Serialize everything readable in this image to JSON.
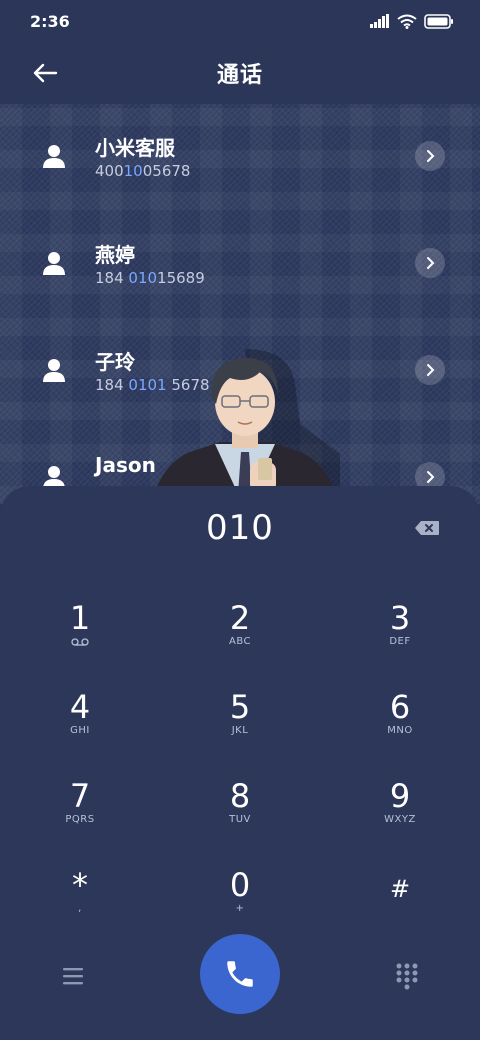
{
  "status_bar": {
    "time": "2:36"
  },
  "header": {
    "title": "通话"
  },
  "contacts": [
    {
      "name": "小米客服",
      "number_parts": [
        {
          "text": "400"
        },
        {
          "text": "10",
          "hl": true
        },
        {
          "text": "05678"
        }
      ]
    },
    {
      "name": "燕婷",
      "number_parts": [
        {
          "text": "184 "
        },
        {
          "text": "010",
          "hl": true
        },
        {
          "text": "15689"
        }
      ]
    },
    {
      "name": "子玲",
      "number_parts": [
        {
          "text": "184 "
        },
        {
          "text": "0101",
          "hl": true
        },
        {
          "text": " 5678"
        }
      ]
    },
    {
      "name": "Jason",
      "number_parts": []
    }
  ],
  "dialer": {
    "input": "010",
    "keys": [
      {
        "digit": "1",
        "letters": "",
        "sub_icon": "voicemail-icon"
      },
      {
        "digit": "2",
        "letters": "ABC"
      },
      {
        "digit": "3",
        "letters": "DEF"
      },
      {
        "digit": "4",
        "letters": "GHI"
      },
      {
        "digit": "5",
        "letters": "JKL"
      },
      {
        "digit": "6",
        "letters": "MNO"
      },
      {
        "digit": "7",
        "letters": "PQRS"
      },
      {
        "digit": "8",
        "letters": "TUV"
      },
      {
        "digit": "9",
        "letters": "WXYZ"
      },
      {
        "digit": "*",
        "letters": ","
      },
      {
        "digit": "0",
        "letters": "+"
      },
      {
        "digit": "#",
        "letters": ""
      }
    ]
  },
  "colors": {
    "background": "#2b3659",
    "accent_call": "#3b66cf",
    "match_highlight": "#7aa8ff"
  }
}
